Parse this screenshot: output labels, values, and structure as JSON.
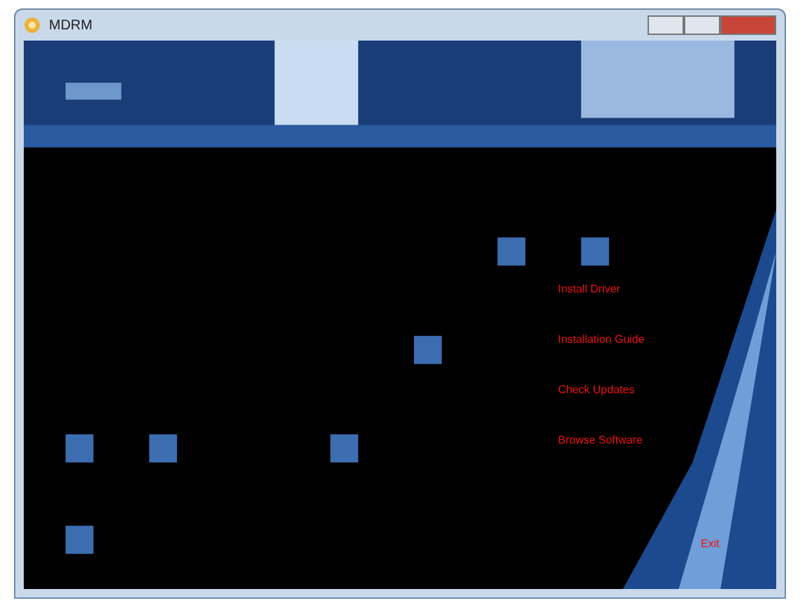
{
  "window": {
    "title": "MDRM"
  },
  "menu": [
    {
      "label": "Install Driver"
    },
    {
      "label": "Installation Guide"
    },
    {
      "label": "Check Updates"
    },
    {
      "label": "Browse Software"
    }
  ],
  "exit": {
    "label": "Exit"
  }
}
